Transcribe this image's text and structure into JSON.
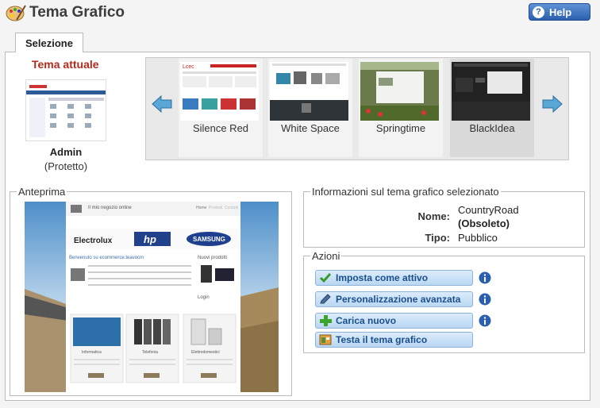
{
  "header": {
    "title": "Tema Grafico",
    "help_label": "Help",
    "app_icon": "palette-icon",
    "help_icon": "question-icon"
  },
  "tabs": [
    {
      "label": "Selezione",
      "active": true
    }
  ],
  "current_theme": {
    "heading": "Tema attuale",
    "name": "Admin",
    "status": "(Protetto)"
  },
  "carousel": {
    "prev_icon": "arrow-left-icon",
    "next_icon": "arrow-right-icon",
    "themes": [
      {
        "name": "Silence Red"
      },
      {
        "name": "White Space"
      },
      {
        "name": "Springtime"
      },
      {
        "name": "BlackIdea",
        "selected": true
      }
    ]
  },
  "preview": {
    "legend": "Anteprima",
    "store_title": "Il mio negozio online",
    "brands": [
      "Electrolux",
      "hp",
      "SAMSUNG"
    ],
    "welcome": "Benvenuto su ecommerce.teavocm",
    "sidebar_title": "Nuovi prodotti",
    "login": "Login",
    "categories": [
      "Informatica",
      "Telefonia",
      "Elettrodomestici"
    ],
    "nav": [
      "Home",
      "Prodotti",
      "Contatti"
    ]
  },
  "info": {
    "legend": "Informazioni sul tema grafico selezionato",
    "name_label": "Nome:",
    "name_value": "CountryRoad",
    "name_note": "(Obsoleto)",
    "type_label": "Tipo:",
    "type_value": "Pubblico"
  },
  "actions": {
    "legend": "Azioni",
    "buttons": [
      {
        "label": "Imposta come attivo",
        "icon": "checkmark-icon",
        "has_info": true
      },
      {
        "label": "Personalizzazione avanzata",
        "icon": "pencil-icon",
        "has_info": true
      },
      {
        "label": "Carica nuovo",
        "icon": "plus-icon",
        "has_info": true
      },
      {
        "label": "Testa il tema grafico",
        "icon": "theme-test-icon",
        "has_info": false
      }
    ]
  },
  "colors": {
    "accent_red": "#b02a1e",
    "action_text": "#1b4f8c",
    "help_blue": "#2a5fae"
  }
}
